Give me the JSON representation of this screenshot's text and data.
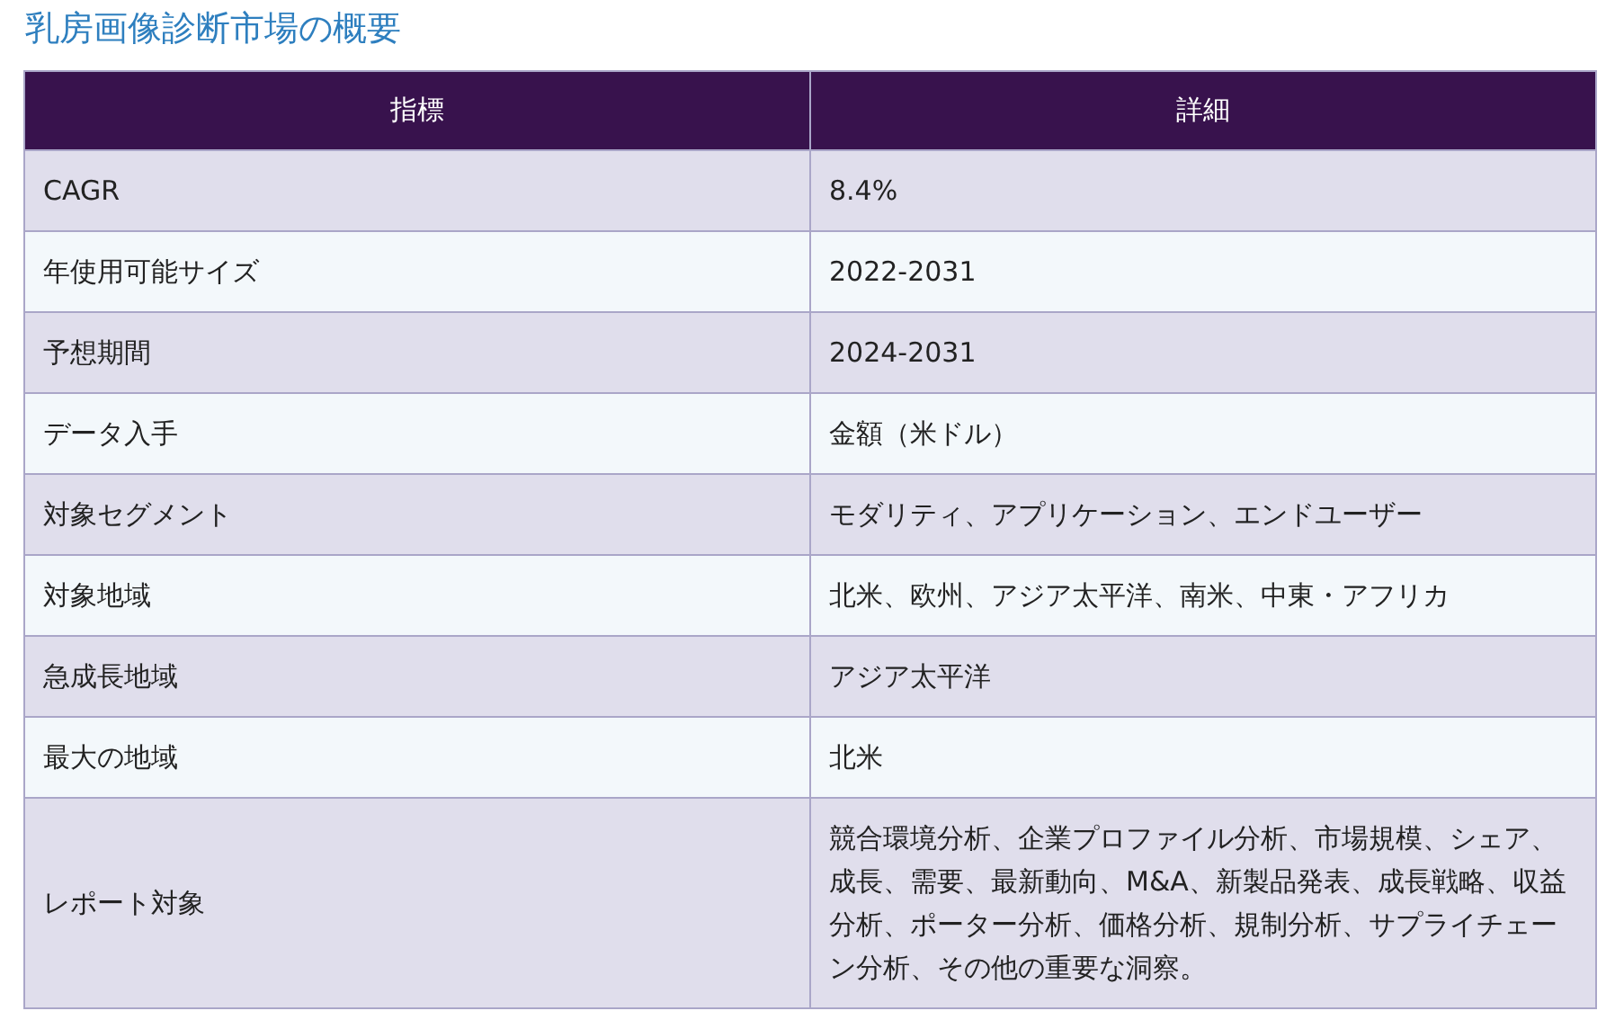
{
  "title": "乳房画像診断市場の概要",
  "table": {
    "columns": [
      "指標",
      "詳細"
    ],
    "rows": [
      [
        "CAGR",
        "8.4%"
      ],
      [
        "年使用可能サイズ",
        "2022-2031"
      ],
      [
        "予想期間",
        "2024-2031"
      ],
      [
        "データ入手",
        "金額（米ドル）"
      ],
      [
        "対象セグメント",
        "モダリティ、アプリケーション、エンドユーザー"
      ],
      [
        "対象地域",
        "北米、欧州、アジア太平洋、南米、中東・アフリカ"
      ],
      [
        "急成長地域",
        "アジア太平洋"
      ],
      [
        "最大の地域",
        "北米"
      ],
      [
        "レポート対象",
        "競合環境分析、企業プロファイル分析、市場規模、シェア、成長、需要、最新動向、M&A、新製品発表、成長戦略、収益分析、ポーター分析、価格分析、規制分析、サプライチェーン分析、その他の重要な洞察。"
      ]
    ]
  }
}
